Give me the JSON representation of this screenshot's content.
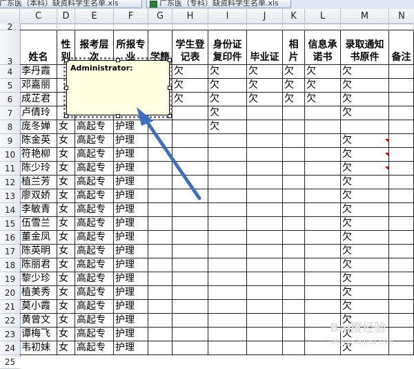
{
  "tabs": [
    {
      "label": "广东医（本科）缺资料学生名单.xls"
    },
    {
      "label": "广东医（专科）缺资料学生名单.xls"
    }
  ],
  "column_letters": [
    "C",
    "D",
    "E",
    "F",
    "G",
    "H",
    "I",
    "J",
    "K",
    "L",
    "M",
    "N"
  ],
  "row_numbers": [
    "2",
    "3",
    "4",
    "5",
    "6",
    "7",
    "8",
    "9",
    "10",
    "11",
    "12",
    "13",
    "14",
    "15",
    "16",
    "17",
    "18",
    "19",
    "20",
    "21",
    "22",
    "23",
    "24",
    "25"
  ],
  "headers": {
    "name": "姓名",
    "gender": "性别",
    "level": "报考层次",
    "major": "所报专业",
    "xueji": "学籍",
    "register": "学生登记表",
    "idcopy": "身份证复印件",
    "diploma": "毕业证",
    "photo": "相片",
    "promise": "信息承诺书",
    "notice": "录取通知书原件",
    "remark": "备注"
  },
  "rows": [
    {
      "name": "李丹霞",
      "gender": "",
      "level": "",
      "major": "",
      "xueji": "",
      "register": "欠",
      "idcopy": "欠",
      "diploma": "欠",
      "photo": "欠",
      "promise": "欠",
      "notice": "欠"
    },
    {
      "name": "邓嘉丽",
      "gender": "",
      "level": "",
      "major": "",
      "xueji": "",
      "register": "欠",
      "idcopy": "欠",
      "diploma": "欠",
      "photo": "欠",
      "promise": "欠",
      "notice": "欠"
    },
    {
      "name": "成芷君",
      "gender": "",
      "level": "",
      "major": "",
      "xueji": "",
      "register": "欠",
      "idcopy": "欠",
      "diploma": "欠",
      "photo": "欠",
      "promise": "欠",
      "notice": "欠"
    },
    {
      "name": "卢倩玲",
      "gender": "",
      "level": "",
      "major": "",
      "xueji": "",
      "register": "",
      "idcopy": "欠",
      "diploma": "",
      "photo": "",
      "promise": "",
      "notice": "欠"
    },
    {
      "name": "庞冬婵",
      "gender": "女",
      "level": "高起专",
      "major": "护理",
      "xueji": "",
      "register": "",
      "idcopy": "欠",
      "diploma": "",
      "photo": "",
      "promise": "",
      "notice": ""
    },
    {
      "name": "陈金英",
      "gender": "女",
      "level": "高起专",
      "major": "护理",
      "xueji": "",
      "register": "",
      "idcopy": "",
      "diploma": "",
      "photo": "",
      "promise": "",
      "notice": "欠"
    },
    {
      "name": "符艳柳",
      "gender": "女",
      "level": "高起专",
      "major": "护理",
      "xueji": "",
      "register": "",
      "idcopy": "",
      "diploma": "",
      "photo": "",
      "promise": "",
      "notice": "欠"
    },
    {
      "name": "陈少玲",
      "gender": "女",
      "level": "高起专",
      "major": "护理",
      "xueji": "",
      "register": "",
      "idcopy": "",
      "diploma": "",
      "photo": "",
      "promise": "",
      "notice": "欠"
    },
    {
      "name": "植兰芳",
      "gender": "女",
      "level": "高起专",
      "major": "护理",
      "xueji": "",
      "register": "",
      "idcopy": "",
      "diploma": "",
      "photo": "",
      "promise": "",
      "notice": "欠"
    },
    {
      "name": "廖双娇",
      "gender": "女",
      "level": "高起专",
      "major": "护理",
      "xueji": "",
      "register": "",
      "idcopy": "",
      "diploma": "",
      "photo": "",
      "promise": "",
      "notice": "欠"
    },
    {
      "name": "李敏青",
      "gender": "女",
      "level": "高起专",
      "major": "护理",
      "xueji": "",
      "register": "",
      "idcopy": "",
      "diploma": "",
      "photo": "",
      "promise": "",
      "notice": "欠"
    },
    {
      "name": "伍雪兰",
      "gender": "女",
      "level": "高起专",
      "major": "护理",
      "xueji": "",
      "register": "",
      "idcopy": "",
      "diploma": "",
      "photo": "",
      "promise": "",
      "notice": "欠"
    },
    {
      "name": "董金凤",
      "gender": "女",
      "level": "高起专",
      "major": "护理",
      "xueji": "",
      "register": "",
      "idcopy": "",
      "diploma": "",
      "photo": "",
      "promise": "",
      "notice": "欠"
    },
    {
      "name": "陈英明",
      "gender": "女",
      "level": "高起专",
      "major": "护理",
      "xueji": "",
      "register": "",
      "idcopy": "",
      "diploma": "",
      "photo": "",
      "promise": "",
      "notice": "欠"
    },
    {
      "name": "陈丽君",
      "gender": "女",
      "level": "高起专",
      "major": "护理",
      "xueji": "",
      "register": "",
      "idcopy": "",
      "diploma": "",
      "photo": "",
      "promise": "",
      "notice": "欠"
    },
    {
      "name": "黎少珍",
      "gender": "女",
      "level": "高起专",
      "major": "护理",
      "xueji": "",
      "register": "",
      "idcopy": "",
      "diploma": "",
      "photo": "",
      "promise": "",
      "notice": "欠"
    },
    {
      "name": "植美秀",
      "gender": "女",
      "level": "高起专",
      "major": "护理",
      "xueji": "",
      "register": "",
      "idcopy": "",
      "diploma": "",
      "photo": "",
      "promise": "",
      "notice": "欠"
    },
    {
      "name": "莫小霞",
      "gender": "女",
      "level": "高起专",
      "major": "护理",
      "xueji": "",
      "register": "",
      "idcopy": "",
      "diploma": "",
      "photo": "",
      "promise": "",
      "notice": "欠"
    },
    {
      "name": "黄曾文",
      "gender": "女",
      "level": "高起专",
      "major": "护理",
      "xueji": "",
      "register": "",
      "idcopy": "",
      "diploma": "",
      "photo": "",
      "promise": "",
      "notice": "欠"
    },
    {
      "name": "谭梅飞",
      "gender": "女",
      "level": "高起专",
      "major": "护理",
      "xueji": "",
      "register": "",
      "idcopy": "",
      "diploma": "",
      "photo": "",
      "promise": "",
      "notice": "欠"
    },
    {
      "name": "韦初妹",
      "gender": "女",
      "level": "高起专",
      "major": "护理",
      "xueji": "",
      "register": "",
      "idcopy": "",
      "diploma": "",
      "photo": "",
      "promise": "",
      "notice": "欠"
    }
  ],
  "comment": {
    "author": "Administrator:"
  },
  "watermark": {
    "text": "Bai度经验",
    "sub": "jingyan.baidu.com"
  },
  "colors": {
    "arrow": "#3b6fc4",
    "comment_bg": "#ffffe1",
    "comment_indicator": "#b00000"
  },
  "icons": {
    "tab_icon": "excel-file-icon",
    "arrow": "pointer-arrow-icon"
  }
}
